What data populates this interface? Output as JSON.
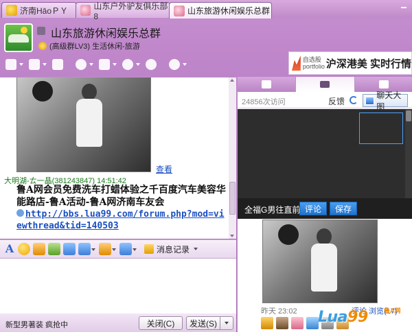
{
  "tabs": [
    {
      "label": "济南HāoＰＹ",
      "active": false
    },
    {
      "label": "山东户外驴友俱乐部8",
      "active": false
    },
    {
      "label": "山东旅游休闲娱乐总群",
      "active": true
    }
  ],
  "header": {
    "title": "山东旅游休闲娱乐总群",
    "subtitle": "(高级群LV3) 生活休闲-旅游"
  },
  "toolbar_icons": [
    "home-icon",
    "folder-icon",
    "album-icon",
    "chat-bubble-icon",
    "notes-icon",
    "location-icon",
    "share-icon",
    "settings-icon"
  ],
  "ad": {
    "small": "自选股 portfolio",
    "big": "沪深港美 实时行情"
  },
  "chat": {
    "see_link": "查看",
    "sender": "大明湖-ㄊ一晶(381243847)  14:51:42",
    "message": "鲁A网会员免费洗车打蜡体验之千百度汽车美容华能路店-鲁A活动-鲁A网济南车友会",
    "link": "http://bbs.lua99.com/forum.php?mod=viewthread&tid=140503"
  },
  "input_toolbar": {
    "history_label": "消息记录"
  },
  "bottom": {
    "status": "新型男著装 疯抢中",
    "close_label": "关闭(C)",
    "send_label": "发送(S)"
  },
  "right": {
    "visits": "24856次访问",
    "feedback": "反馈",
    "bigpic_label": "聊天大图",
    "caption": "全福G男往直前",
    "comment_label": "评论",
    "save_label": "保存",
    "time": "昨天 23:02",
    "links": "评论  浏览(17)"
  },
  "watermark": {
    "text_a": "Lua",
    "text_b": "99",
    "sub": "鲁A网"
  }
}
